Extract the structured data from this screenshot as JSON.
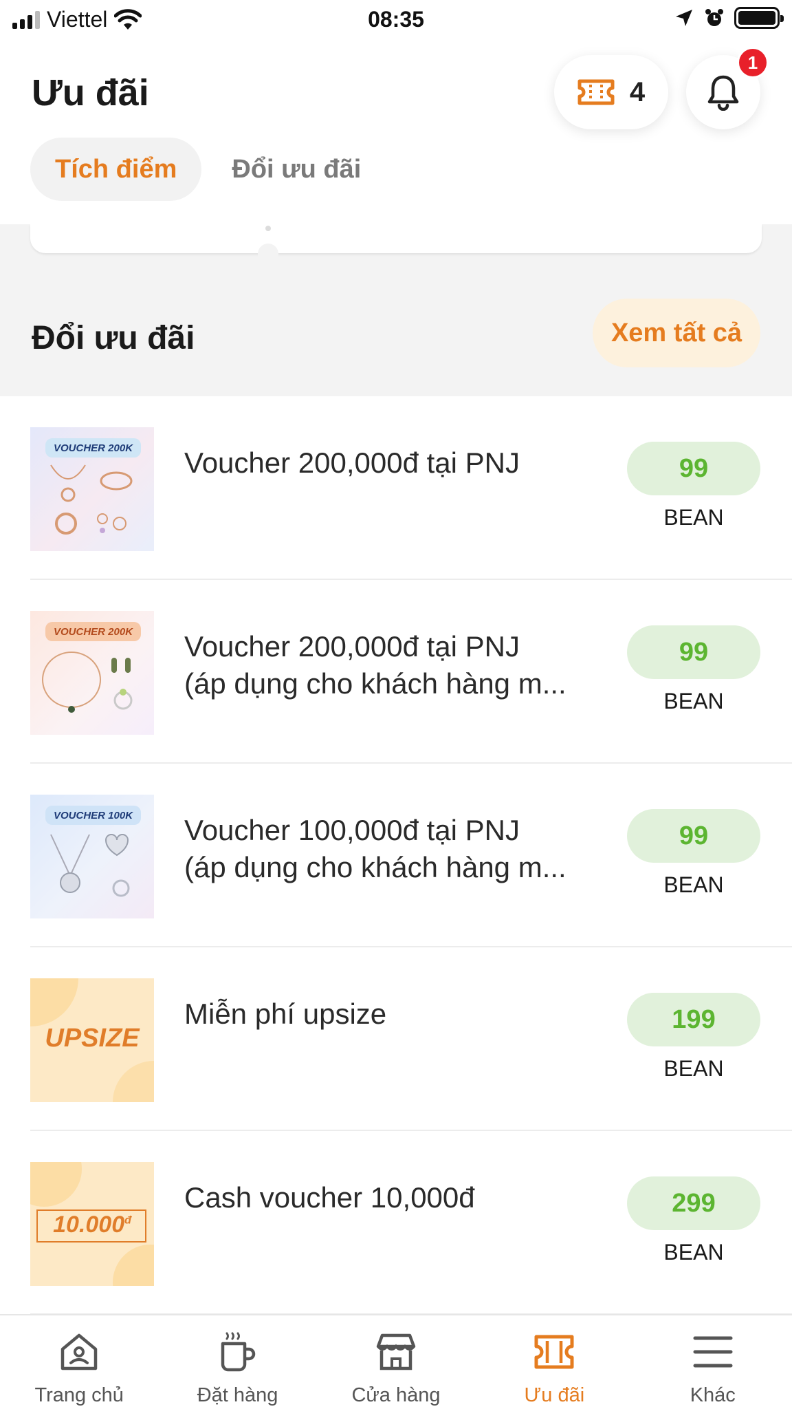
{
  "status_bar": {
    "carrier": "Viettel",
    "time": "08:35"
  },
  "header": {
    "title": "Ưu đãi",
    "voucher_count": "4",
    "notification_count": "1",
    "tabs": [
      {
        "label": "Tích điểm",
        "active": true
      },
      {
        "label": "Đổi ưu đãi",
        "active": false
      }
    ]
  },
  "section": {
    "title": "Đổi ưu đãi",
    "view_all_label": "Xem tất cả"
  },
  "rewards": [
    {
      "title_line1": "Voucher 200,000đ tại PNJ",
      "title_line2": "",
      "price": "99",
      "unit": "BEAN",
      "thumb_tag": "VOUCHER 200K"
    },
    {
      "title_line1": "Voucher 200,000đ tại PNJ",
      "title_line2": "(áp dụng cho khách hàng m...",
      "price": "99",
      "unit": "BEAN",
      "thumb_tag": "VOUCHER 200K"
    },
    {
      "title_line1": "Voucher 100,000đ tại PNJ",
      "title_line2": "(áp dụng cho khách hàng m...",
      "price": "99",
      "unit": "BEAN",
      "thumb_tag": "VOUCHER 100K"
    },
    {
      "title_line1": "Miễn phí upsize",
      "title_line2": "",
      "price": "199",
      "unit": "BEAN",
      "thumb_text": "UPSIZE"
    },
    {
      "title_line1": "Cash voucher 10,000đ",
      "title_line2": "",
      "price": "299",
      "unit": "BEAN",
      "thumb_text": "10.000",
      "thumb_currency": "đ"
    }
  ],
  "bottom_nav": [
    {
      "label": "Trang chủ",
      "icon": "home-icon",
      "active": false
    },
    {
      "label": "Đặt hàng",
      "icon": "coffee-cup-icon",
      "active": false
    },
    {
      "label": "Cửa hàng",
      "icon": "store-icon",
      "active": false
    },
    {
      "label": "Ưu đãi",
      "icon": "ticket-icon",
      "active": true
    },
    {
      "label": "Khác",
      "icon": "menu-icon",
      "active": false
    }
  ],
  "colors": {
    "accent": "#e57c1f",
    "price_green": "#5cb531",
    "price_bg": "#e1f1db",
    "badge_red": "#e8202a",
    "band_grey": "#f3f3f3"
  }
}
